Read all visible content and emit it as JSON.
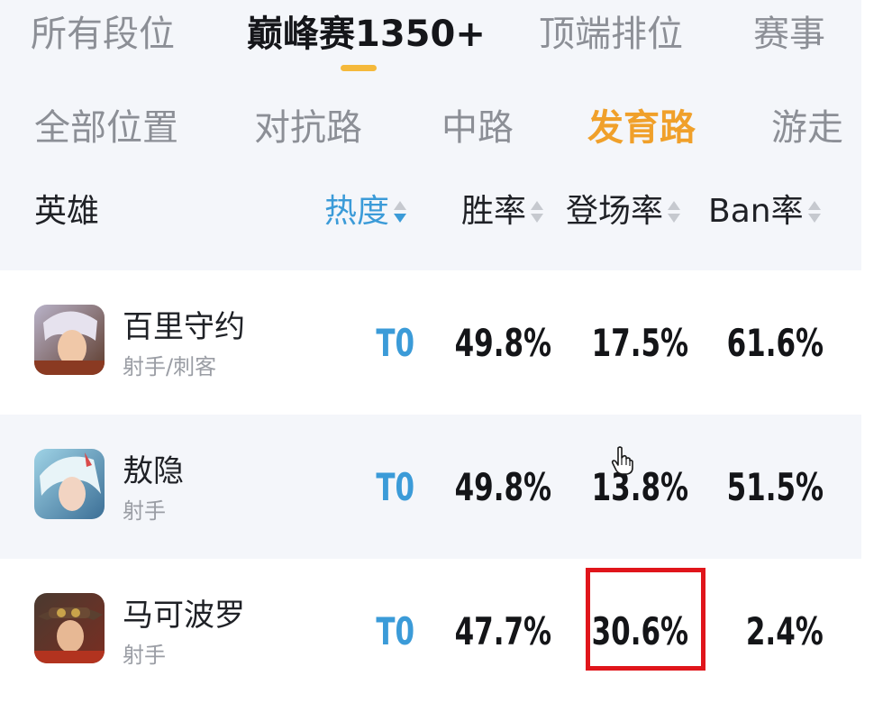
{
  "rank_tabs": [
    {
      "label": "所有段位",
      "active": false
    },
    {
      "label": "巅峰赛1350+",
      "active": true
    },
    {
      "label": "顶端排位",
      "active": false
    },
    {
      "label": "赛事",
      "active": false
    }
  ],
  "position_tabs": [
    {
      "label": "全部位置",
      "active": false
    },
    {
      "label": "对抗路",
      "active": false
    },
    {
      "label": "中路",
      "active": false
    },
    {
      "label": "发育路",
      "active": true
    },
    {
      "label": "游走",
      "active": false
    }
  ],
  "columns": {
    "hero": "英雄",
    "heat": "热度",
    "win_rate": "胜率",
    "pick_rate": "登场率",
    "ban_rate": "Ban率"
  },
  "heroes": [
    {
      "name": "百里守约",
      "role": "射手/刺客",
      "tier": "T0",
      "win_rate": "49.8%",
      "pick_rate": "17.5%",
      "ban_rate": "61.6%"
    },
    {
      "name": "敖隐",
      "role": "射手",
      "tier": "T0",
      "win_rate": "49.8%",
      "pick_rate": "13.8%",
      "ban_rate": "51.5%"
    },
    {
      "name": "马可波罗",
      "role": "射手",
      "tier": "T0",
      "win_rate": "47.7%",
      "pick_rate": "30.6%",
      "ban_rate": "2.4%"
    }
  ],
  "colors": {
    "active_rank_underline": "#f5b93b",
    "active_position": "#f0a02a",
    "heat_sort": "#3b9bd8",
    "tier": "#3b9bd8",
    "highlight_box": "#e0151b"
  }
}
